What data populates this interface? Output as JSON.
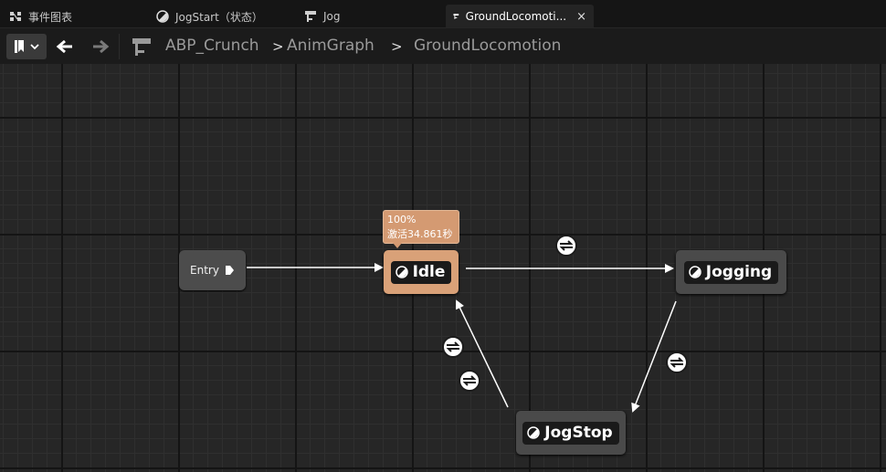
{
  "tabs": [
    {
      "label": "事件图表",
      "icon": "event-graph-icon",
      "active": false
    },
    {
      "label": "JogStart（状态）",
      "icon": "state-icon",
      "active": false
    },
    {
      "label": "Jog",
      "icon": "state-machine-icon",
      "active": false
    },
    {
      "label": "GroundLocomoti...",
      "icon": "state-machine-icon",
      "active": true,
      "close": "×"
    }
  ],
  "toolbar": {
    "bookmark_icon": "bookmark-icon",
    "back_icon": "back-arrow-icon",
    "forward_icon": "forward-arrow-icon",
    "breadcrumb": [
      "ABP_Crunch",
      "AnimGraph",
      "GroundLocomotion"
    ],
    "breadcrumb_separator": ">"
  },
  "graph": {
    "entry": {
      "label": "Entry"
    },
    "states": [
      {
        "id": "idle",
        "label": "Idle",
        "active": true,
        "color": "#d9a178"
      },
      {
        "id": "jogging",
        "label": "Jogging",
        "active": false,
        "color": "#4a4a4a"
      },
      {
        "id": "jogstop",
        "label": "JogStop",
        "active": false,
        "color": "#4a4a4a"
      }
    ],
    "active_tooltip": {
      "percent": "100%",
      "time": "激活34.861秒"
    },
    "transitions": [
      {
        "from": "Idle",
        "to": "Jogging"
      },
      {
        "from": "Jogging",
        "to": "JogStop"
      },
      {
        "from": "JogStop",
        "to": "Idle"
      },
      {
        "from": "JogStop",
        "to": "Idle"
      }
    ]
  }
}
